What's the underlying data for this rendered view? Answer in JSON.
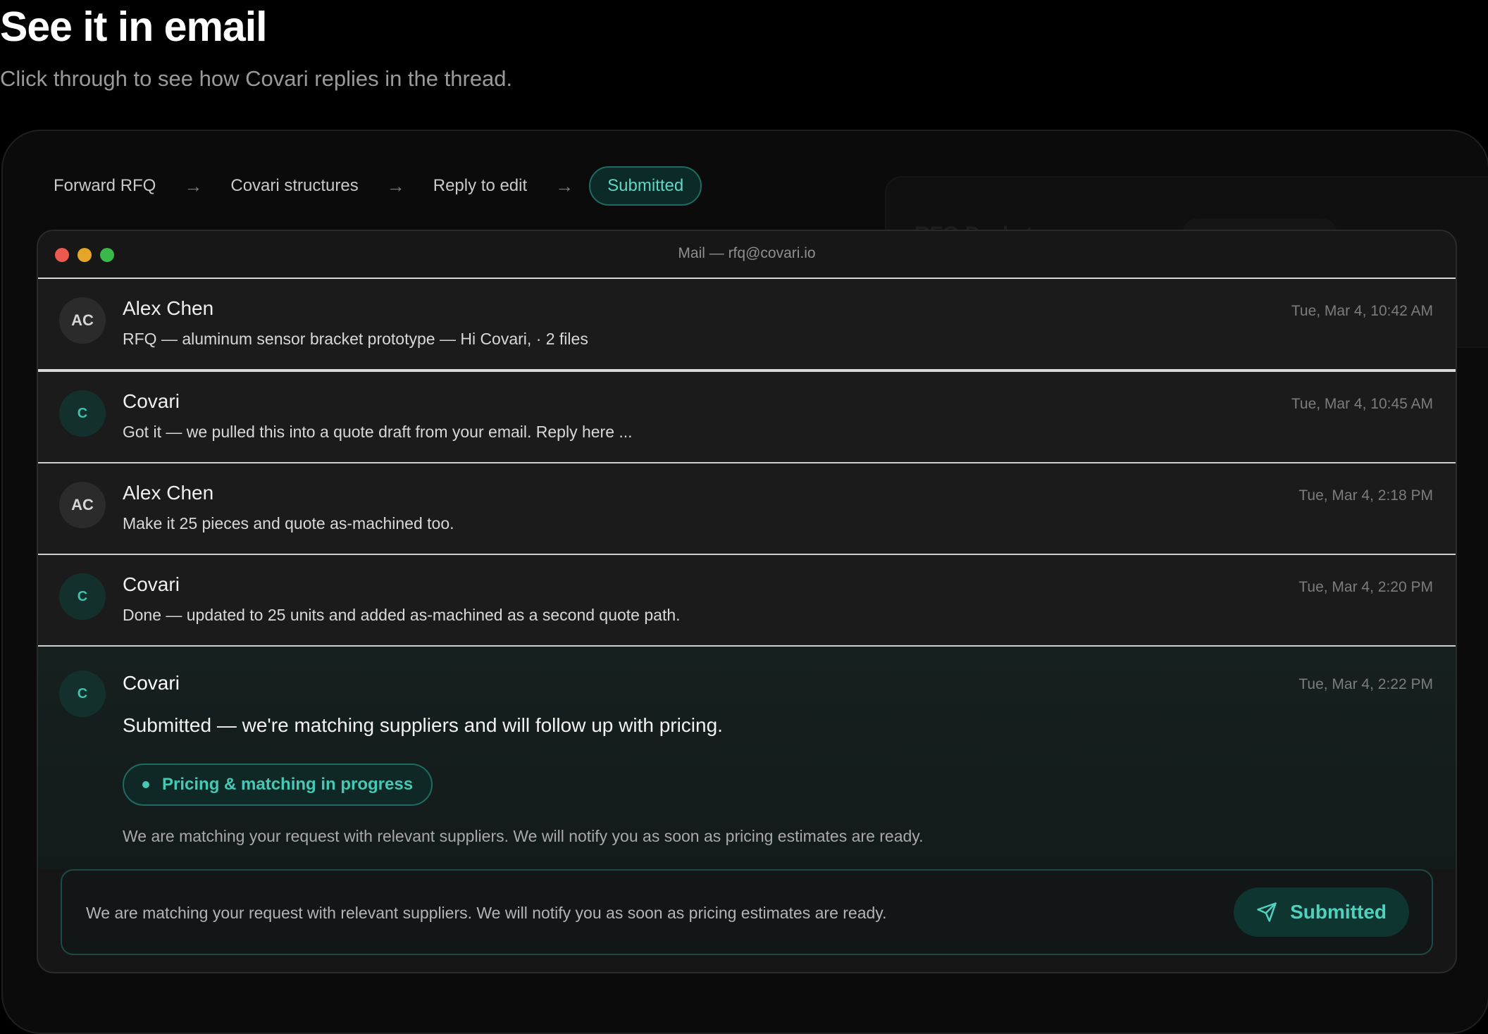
{
  "header": {
    "title": "See it in email",
    "subtitle": "Click through to see how Covari replies in the thread."
  },
  "stepper": {
    "steps": [
      {
        "label": "Forward RFQ",
        "active": false
      },
      {
        "label": "Covari structures",
        "active": false
      },
      {
        "label": "Reply to edit",
        "active": false
      },
      {
        "label": "Submitted",
        "active": true
      }
    ],
    "arrow_icon": "arrow-right-icon"
  },
  "background_card": {
    "title": "RFQ Packet",
    "badge": "Ready to Quote"
  },
  "mail": {
    "window_title": "Mail — rfq@covari.io",
    "messages": [
      {
        "initials": "AC",
        "sender": "Alex Chen",
        "preview": "RFQ — aluminum sensor bracket prototype — Hi Covari, · 2 files",
        "timestamp": "Tue, Mar 4, 10:42 AM"
      },
      {
        "initials": "C",
        "sender": "Covari",
        "preview": "Got it — we pulled this into a quote draft from your email. Reply here ...",
        "timestamp": "Tue, Mar 4, 10:45 AM"
      },
      {
        "initials": "AC",
        "sender": "Alex Chen",
        "preview": "Make it 25 pieces and quote as-machined too.",
        "timestamp": "Tue, Mar 4, 2:18 PM"
      },
      {
        "initials": "C",
        "sender": "Covari",
        "preview": "Done — updated to 25 units and added as-machined as a second quote path.",
        "timestamp": "Tue, Mar 4, 2:20 PM"
      }
    ],
    "expanded": {
      "initials": "C",
      "sender": "Covari",
      "timestamp": "Tue, Mar 4, 2:22 PM",
      "body": "Submitted — we're matching suppliers and will follow up with pricing.",
      "status_pill": "Pricing & matching in progress",
      "note": "We are matching your request with relevant suppliers. We will notify you as soon as pricing estimates are ready."
    },
    "compose": {
      "value": "We are matching your request with relevant suppliers. We will notify you as soon as pricing estimates are ready.",
      "button_label": "Submitted",
      "button_icon": "send-icon"
    }
  },
  "colors": {
    "accent": "#46c8b4",
    "accent_bg": "#0f2825",
    "traffic_red": "#ec5a4f",
    "traffic_yellow": "#e5a526",
    "traffic_green": "#38b94a"
  }
}
